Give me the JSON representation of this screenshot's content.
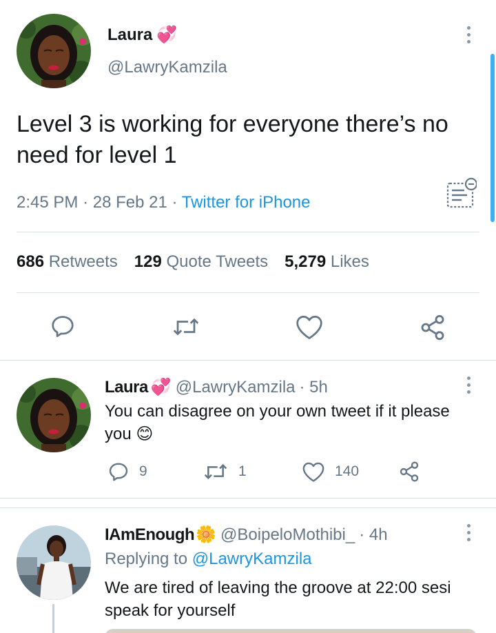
{
  "main_tweet": {
    "author_name": "Laura",
    "author_emoji": "💞",
    "handle": "@LawryKamzila",
    "text": "Level 3 is working for everyone there’s no need for level 1",
    "time": "2:45 PM",
    "date": "28 Feb 21",
    "dot": "·",
    "source": "Twitter for iPhone",
    "stats": {
      "retweets_count": "686",
      "retweets_label": "Retweets",
      "quotes_count": "129",
      "quotes_label": "Quote Tweets",
      "likes_count": "5,279",
      "likes_label": "Likes"
    }
  },
  "replies": [
    {
      "author_name": "Laura",
      "author_emoji": "💞",
      "handle": "@LawryKamzila",
      "time_ago": "· 5h",
      "text": "You can disagree on your own tweet if it please you 😊",
      "reply_count": "9",
      "retweet_count": "1",
      "like_count": "140"
    },
    {
      "author_name": "IAmEnough",
      "author_emoji": "🌼",
      "handle": "@BoipeloMothibi_",
      "time_ago": "· 4h",
      "replying_prefix": "Replying to",
      "replying_to": "@LawryKamzila",
      "text": "We are tired of leaving the groove at 22:00 sesi speak for yourself"
    }
  ],
  "colors": {
    "accent": "#1da1f2",
    "link": "#1b95e0",
    "secondary_text": "#657786",
    "icon_gray": "#657786"
  },
  "icons": [
    "more-vertical-icon",
    "notes-icon",
    "reply-icon",
    "retweet-icon",
    "like-icon",
    "share-icon"
  ]
}
